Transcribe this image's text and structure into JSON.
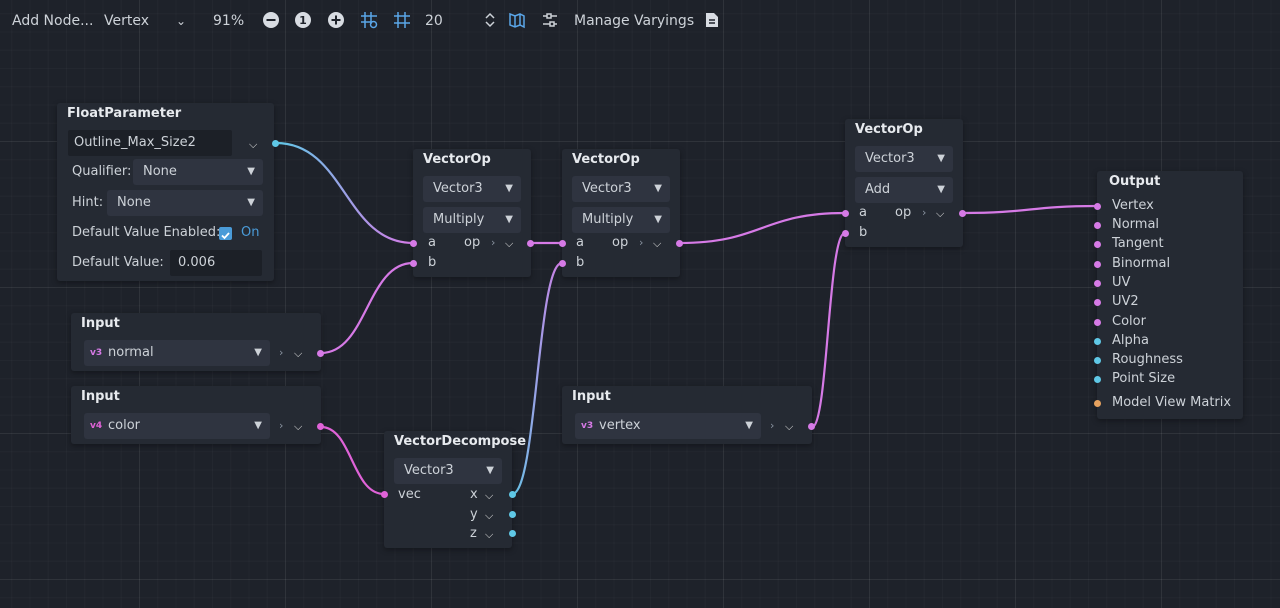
{
  "toolbar": {
    "add_node": "Add Node...",
    "mode": "Vertex",
    "zoom": "91%",
    "snap_value": "20",
    "manage_varyings": "Manage Varyings"
  },
  "icons": {
    "zoom_out": "zoom-out-icon",
    "zoom_reset": "zoom-reset-icon",
    "zoom_in": "zoom-in-icon",
    "grid": "grid-icon",
    "snap": "snap-icon",
    "minimap": "minimap-icon",
    "arrange": "arrange-icon",
    "script": "script-icon"
  },
  "colors": {
    "vector_port": "#d67ae6",
    "scalar_port": "#5fc8e6",
    "transform_port": "#e6a25f",
    "accent": "#4a9bd8",
    "background": "#1e222a",
    "node_bg": "#252a33"
  },
  "float_param": {
    "title": "FloatParameter",
    "name": "Outline_Max_Size2",
    "qualifier_label": "Qualifier:",
    "qualifier": "None",
    "hint_label": "Hint:",
    "hint": "None",
    "dve_label": "Default Value Enabled:",
    "dve_value": "On",
    "dv_label": "Default Value:",
    "dv_value": "0.006"
  },
  "input_normal": {
    "title": "Input",
    "value": "normal",
    "type_icon": "vec3-icon"
  },
  "input_color": {
    "title": "Input",
    "value": "color",
    "type_icon": "vec4-icon"
  },
  "input_vertex": {
    "title": "Input",
    "value": "vertex",
    "type_icon": "vec3-icon"
  },
  "vop1": {
    "title": "VectorOp",
    "type": "Vector3",
    "op": "Multiply",
    "port_a": "a",
    "port_b": "b",
    "port_out": "op"
  },
  "vop2": {
    "title": "VectorOp",
    "type": "Vector3",
    "op": "Multiply",
    "port_a": "a",
    "port_b": "b",
    "port_out": "op"
  },
  "vop3": {
    "title": "VectorOp",
    "type": "Vector3",
    "op": "Add",
    "port_a": "a",
    "port_b": "b",
    "port_out": "op"
  },
  "vdecomp": {
    "title": "VectorDecompose",
    "type": "Vector3",
    "port_in": "vec",
    "port_x": "x",
    "port_y": "y",
    "port_z": "z"
  },
  "output": {
    "title": "Output",
    "ports": [
      "Vertex",
      "Normal",
      "Tangent",
      "Binormal",
      "UV",
      "UV2",
      "Color",
      "Alpha",
      "Roughness",
      "Point Size",
      "Model View Matrix"
    ]
  }
}
